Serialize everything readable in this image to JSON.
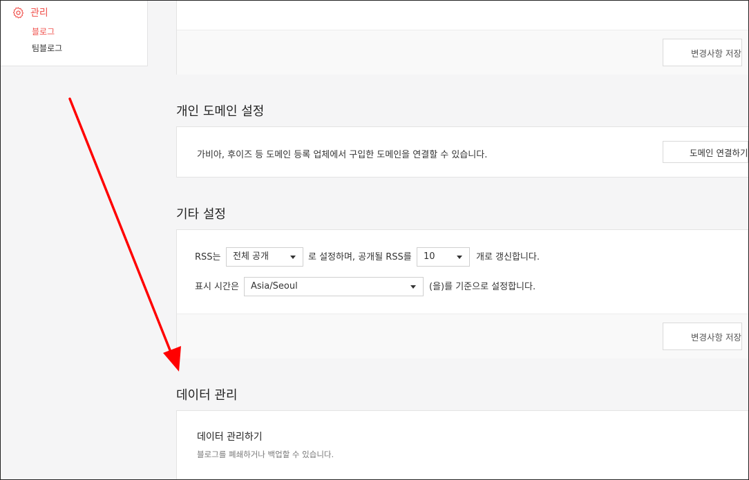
{
  "sidebar": {
    "section_label": "관리",
    "items": [
      {
        "label": "블로그",
        "active": true
      },
      {
        "label": "팀블로그",
        "active": false
      }
    ]
  },
  "top_card": {
    "save_label": "변경사항 저장"
  },
  "domain_section": {
    "title": "개인 도메인 설정",
    "description": "가비아, 후이즈 등 도메인 등록 업체에서 구입한 도메인을 연결할 수 있습니다.",
    "connect_label": "도메인 연결하기"
  },
  "etc_section": {
    "title": "기타 설정",
    "rss_prefix": "RSS는",
    "rss_scope_value": "전체 공개",
    "rss_mid": "로 설정하며, 공개될 RSS를",
    "rss_count_value": "10",
    "rss_suffix": "개로 갱신합니다.",
    "time_prefix": "표시 시간은",
    "timezone_value": "Asia/Seoul",
    "time_suffix": "(을)를 기준으로 설정합니다.",
    "save_label": "변경사항 저장"
  },
  "data_section": {
    "title": "데이터 관리",
    "item_title": "데이터 관리하기",
    "item_desc": "블로그를 폐쇄하거나 백업할 수 있습니다."
  },
  "colors": {
    "accent": "#f0524d",
    "annotation_arrow": "#ff0000"
  }
}
